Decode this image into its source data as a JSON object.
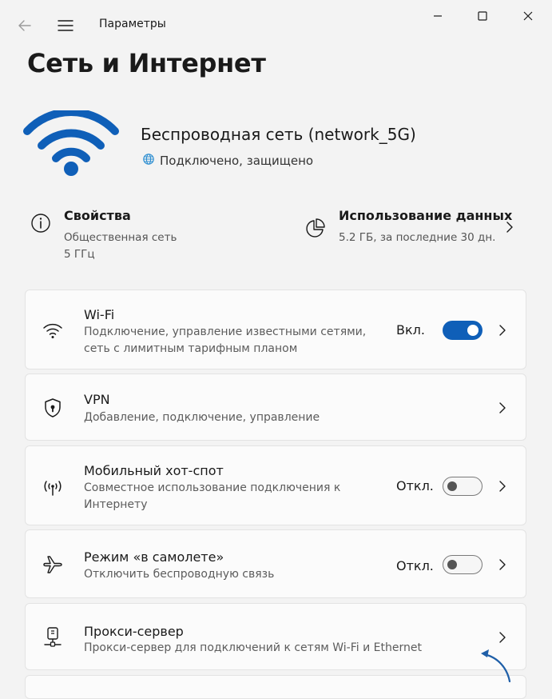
{
  "titlebar": {
    "app_title": "Параметры"
  },
  "page": {
    "title": "Сеть и Интернет"
  },
  "network": {
    "name": "Беспроводная сеть (network_5G)",
    "status": "Подключено, защищено",
    "accent": "#0f5fb8"
  },
  "properties": {
    "title": "Свойства",
    "line1": "Общественная сеть",
    "line2": "5 ГГц"
  },
  "data_usage": {
    "title": "Использование данных",
    "line1": "5.2 ГБ, за последние 30 дн."
  },
  "cards": {
    "wifi": {
      "title": "Wi-Fi",
      "desc": "Подключение, управление известными сетями, сеть с лимитным тарифным планом",
      "state": "Вкл.",
      "toggle_on": true,
      "icon": "wifi-icon"
    },
    "vpn": {
      "title": "VPN",
      "desc": "Добавление, подключение, управление",
      "icon": "vpn-shield-icon"
    },
    "hotspot": {
      "title": "Мобильный хот-спот",
      "desc": "Совместное использование подключения к Интернету",
      "state": "Откл.",
      "toggle_on": false,
      "icon": "hotspot-icon"
    },
    "airplane": {
      "title": "Режим «в самолете»",
      "desc": "Отключить беспроводную связь",
      "state": "Откл.",
      "toggle_on": false,
      "icon": "airplane-icon"
    },
    "proxy": {
      "title": "Прокси-сервер",
      "desc": "Прокси-сервер для подключений к сетям Wi-Fi и Ethernet",
      "icon": "proxy-server-icon"
    }
  }
}
